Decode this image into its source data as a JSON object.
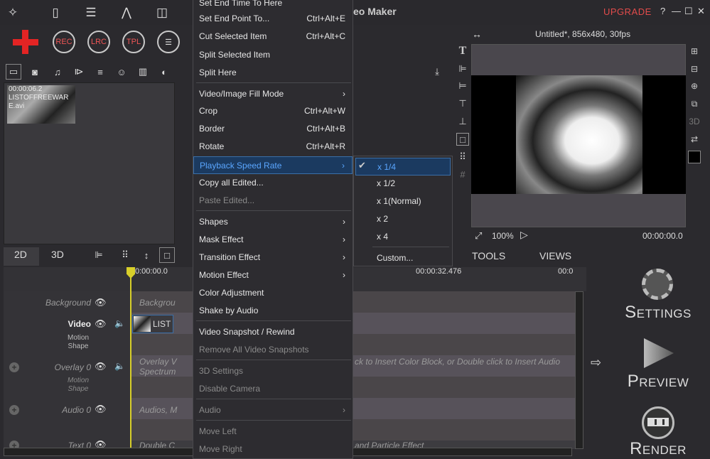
{
  "app": {
    "title": "eo Maker",
    "upgrade": "UPGRADE",
    "help": "?",
    "minimize": "—",
    "maximize": "☐",
    "close": "✕"
  },
  "toolbar": {
    "add": "+",
    "rec": "REC",
    "lrc": "LRC",
    "tpl": "TPL",
    "list": "☰"
  },
  "media": {
    "items": [
      {
        "duration": "00:00:06.2",
        "name": "LISTOFFREEWARE.avi"
      }
    ]
  },
  "timeline": {
    "tab2d": "2D",
    "tab3d": "3D",
    "time0": "0:00:00.0",
    "time1": "00:00:32.476",
    "time2": "00:0",
    "tracks": [
      {
        "label": "Background",
        "content": "Backgrou"
      },
      {
        "label": "Video",
        "sub1": "Motion",
        "sub2": "Shape",
        "clip": "LIST"
      },
      {
        "label": "Overlay 0",
        "sub1": "Motion",
        "sub2": "Shape",
        "content": "Overlay V",
        "content2": "Spectrum",
        "hint": "ck to Insert Color Block, or Double click to Insert Audio"
      },
      {
        "label": "Audio 0",
        "content": "Audios, M"
      },
      {
        "label": "Text 0",
        "content": "Double C",
        "hint": "and Particle Effect"
      }
    ]
  },
  "menu": {
    "items": [
      {
        "label": "Set End Time To Here",
        "sc": ""
      },
      {
        "label": "Set End Point To...",
        "sc": "Ctrl+Alt+E"
      },
      {
        "label": "Cut Selected Item",
        "sc": "Ctrl+Alt+C"
      },
      {
        "label": "Split Selected Item",
        "sc": ""
      },
      {
        "label": "Split Here",
        "sc": ""
      },
      {
        "label": "Video/Image Fill Mode",
        "sc": ""
      },
      {
        "label": "Crop",
        "sc": "Ctrl+Alt+W"
      },
      {
        "label": "Border",
        "sc": "Ctrl+Alt+B"
      },
      {
        "label": "Rotate",
        "sc": "Ctrl+Alt+R"
      },
      {
        "label": "Playback Speed Rate",
        "sc": ""
      },
      {
        "label": "Copy all Edited...",
        "sc": ""
      },
      {
        "label": "Paste Edited...",
        "sc": ""
      },
      {
        "label": "Shapes",
        "sc": ""
      },
      {
        "label": "Mask Effect",
        "sc": ""
      },
      {
        "label": "Transition Effect",
        "sc": ""
      },
      {
        "label": "Motion Effect",
        "sc": ""
      },
      {
        "label": "Color Adjustment",
        "sc": ""
      },
      {
        "label": "Shake by Audio",
        "sc": ""
      },
      {
        "label": "Video Snapshot / Rewind",
        "sc": ""
      },
      {
        "label": "Remove All Video Snapshots",
        "sc": ""
      },
      {
        "label": "3D Settings",
        "sc": ""
      },
      {
        "label": "Disable Camera",
        "sc": ""
      },
      {
        "label": "Audio",
        "sc": ""
      },
      {
        "label": "Move Left",
        "sc": ""
      },
      {
        "label": "Move Right",
        "sc": ""
      }
    ]
  },
  "submenu": {
    "items": [
      "x 1/4",
      "x 1/2",
      "x 1(Normal)",
      "x 2",
      "x 4",
      "Custom..."
    ]
  },
  "preview": {
    "title": "Untitled*, 856x480, 30fps",
    "zoom": "100%",
    "time": "00:00:00.0"
  },
  "panels": {
    "tools": "TOOLS",
    "views": "VIEWS"
  },
  "actions": {
    "settings": "ETTINGS",
    "settings_cap": "S",
    "preview": "REVIEW",
    "preview_cap": "P",
    "render": "ENDER",
    "render_cap": "R"
  }
}
